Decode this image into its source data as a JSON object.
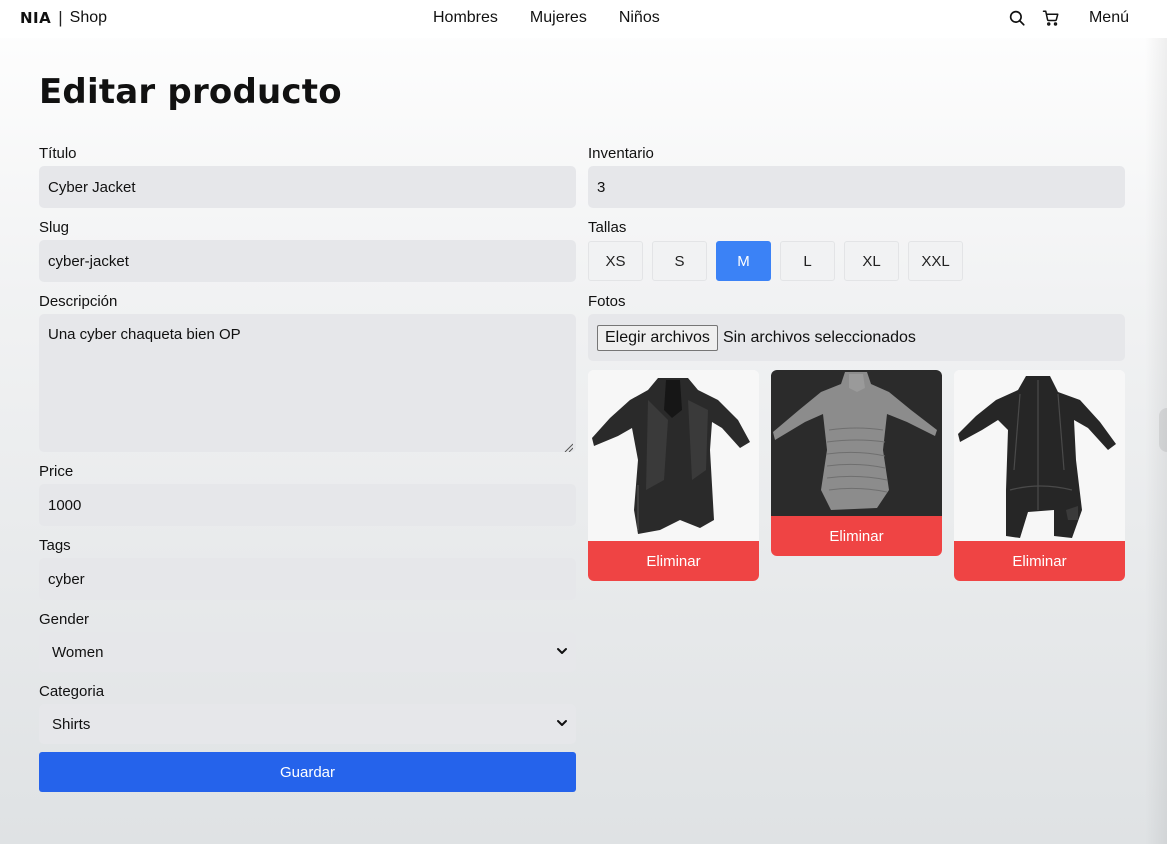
{
  "nav": {
    "brand_logo": "NIA",
    "brand_separator": "|",
    "brand_shop": "Shop",
    "links": [
      "Hombres",
      "Mujeres",
      "Niños"
    ],
    "menu_label": "Menú"
  },
  "page": {
    "title": "Editar producto"
  },
  "form": {
    "title_label": "Título",
    "title_value": "Cyber Jacket",
    "slug_label": "Slug",
    "slug_value": "cyber-jacket",
    "description_label": "Descripción",
    "description_value": "Una cyber chaqueta bien OP",
    "price_label": "Price",
    "price_value": "1000",
    "tags_label": "Tags",
    "tags_value": "cyber",
    "gender_label": "Gender",
    "gender_value": "Women",
    "category_label": "Categoria",
    "category_value": "Shirts",
    "save_label": "Guardar",
    "inventory_label": "Inventario",
    "inventory_value": "3",
    "sizes_label": "Tallas",
    "sizes": [
      "XS",
      "S",
      "M",
      "L",
      "XL",
      "XXL"
    ],
    "selected_size": "M",
    "photos_label": "Fotos",
    "file_button_label": "Elegir archivos",
    "file_status": "Sin archivos seleccionados"
  },
  "photos": [
    {
      "delete_label": "Eliminar"
    },
    {
      "delete_label": "Eliminar"
    },
    {
      "delete_label": "Eliminar"
    }
  ],
  "colors": {
    "primary": "#2563eb",
    "size_active": "#3b82f6",
    "danger": "#ef4444",
    "input_bg": "#e6e7ea"
  }
}
